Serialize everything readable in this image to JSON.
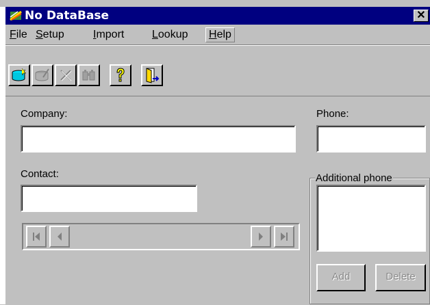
{
  "window": {
    "title": "No DataBase",
    "close_glyph": "✕",
    "title_bar_color": "#000080",
    "face_color": "#c0c0c0"
  },
  "menu": {
    "items": [
      {
        "label": "File",
        "mnemonic": "F",
        "rest": "ile"
      },
      {
        "label": "Setup",
        "mnemonic": "S",
        "rest": "etup"
      },
      {
        "label": "Import",
        "mnemonic": "I",
        "rest": "mport"
      },
      {
        "label": "Lookup",
        "mnemonic": "L",
        "rest": "ookup"
      },
      {
        "label": "Help",
        "mnemonic": "H",
        "rest": "elp"
      }
    ],
    "active": "Help"
  },
  "toolbar": {
    "buttons": [
      {
        "icon": "new-database-icon",
        "enabled": true
      },
      {
        "icon": "edit-record-icon",
        "enabled": false
      },
      {
        "icon": "delete-record-icon",
        "enabled": false
      },
      {
        "icon": "find-icon",
        "enabled": false
      },
      {
        "icon": "help-icon",
        "enabled": true
      },
      {
        "icon": "exit-door-icon",
        "enabled": true
      }
    ]
  },
  "form": {
    "company_label": "Company:",
    "company_value": "",
    "contact_label": "Contact:",
    "contact_value": "",
    "phone_label": "Phone:",
    "phone_value": "",
    "additional_phone_label": "Additional phone",
    "additional_phone_value": ""
  },
  "buttons": {
    "add_label": "Add",
    "delete_label": "Delete"
  },
  "navigator": {
    "icons": [
      "first-record-icon",
      "previous-record-icon",
      "next-record-icon",
      "last-record-icon"
    ]
  }
}
